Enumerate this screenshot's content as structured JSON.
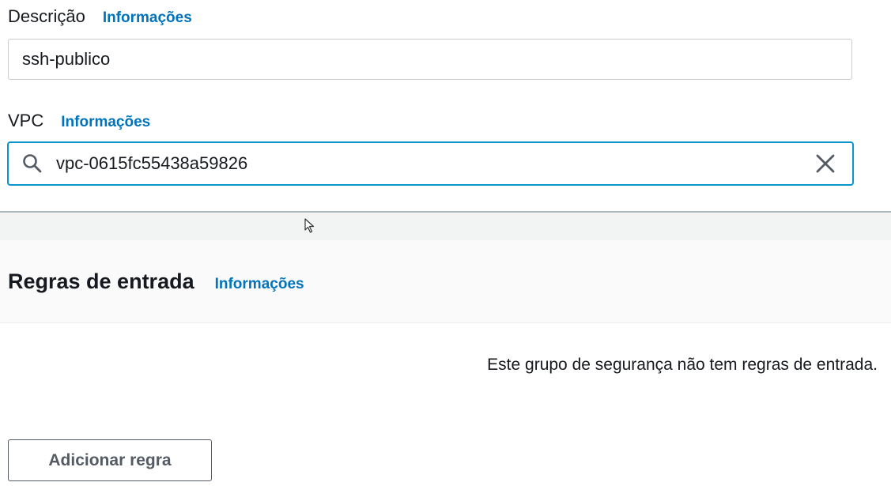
{
  "description": {
    "label": "Descrição",
    "info_link": "Informações",
    "value": "ssh-publico"
  },
  "vpc": {
    "label": "VPC",
    "info_link": "Informações",
    "value": "vpc-0615fc55438a59826",
    "search_icon": "search-icon",
    "clear_icon": "close-icon"
  },
  "inbound_rules": {
    "title": "Regras de entrada",
    "info_link": "Informações",
    "empty_message": "Este grupo de segurança não tem regras de entrada.",
    "add_button_label": "Adicionar regra"
  },
  "colors": {
    "accent": "#0073bb",
    "focus_border": "#0a95cf"
  }
}
